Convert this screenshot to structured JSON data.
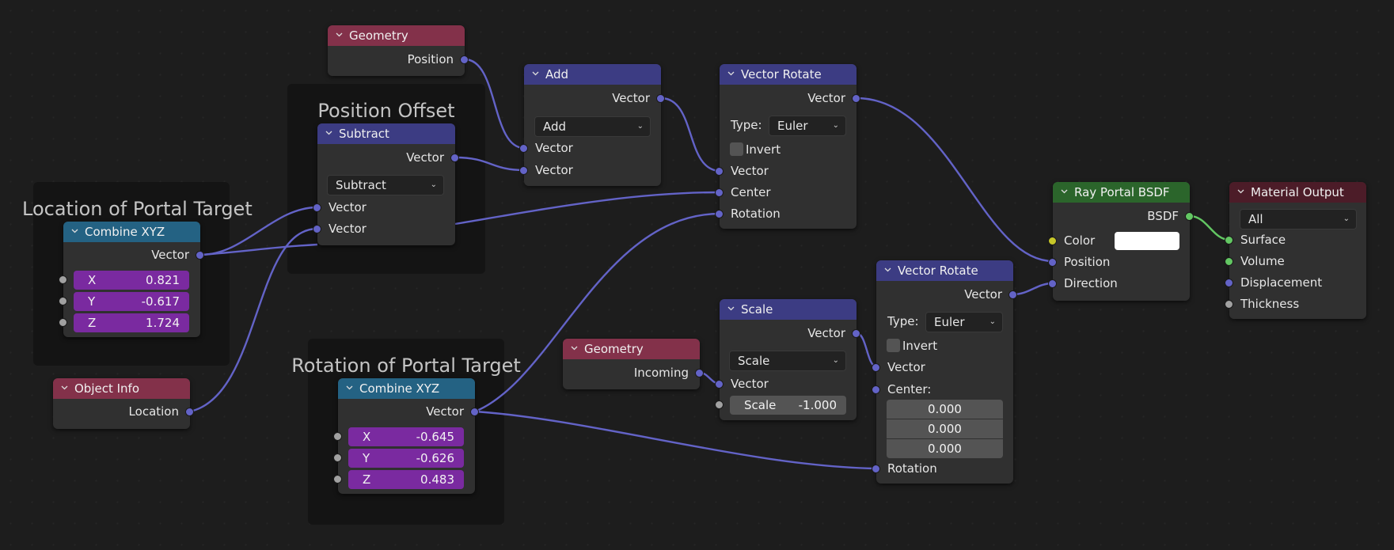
{
  "frames": [
    {
      "label": "Location of Portal Target"
    },
    {
      "label": "Position Offset"
    },
    {
      "label": "Rotation of Portal Target"
    }
  ],
  "nodes": {
    "geometry_top": {
      "title": "Geometry",
      "outputs": [
        "Position"
      ]
    },
    "subtract": {
      "title": "Subtract",
      "output": "Vector",
      "operation": "Subtract",
      "inputs": [
        "Vector",
        "Vector"
      ]
    },
    "add": {
      "title": "Add",
      "output": "Vector",
      "operation": "Add",
      "inputs": [
        "Vector",
        "Vector"
      ]
    },
    "vector_rotate_top": {
      "title": "Vector Rotate",
      "output": "Vector",
      "type_label": "Type:",
      "type_value": "Euler",
      "invert_label": "Invert",
      "inputs": [
        "Vector",
        "Center",
        "Rotation"
      ]
    },
    "combine_location": {
      "title": "Combine XYZ",
      "output": "Vector",
      "fields": [
        {
          "label": "X",
          "value": "0.821"
        },
        {
          "label": "Y",
          "value": "-0.617"
        },
        {
          "label": "Z",
          "value": "1.724"
        }
      ]
    },
    "object_info": {
      "title": "Object Info",
      "outputs": [
        "Location"
      ]
    },
    "combine_rotation": {
      "title": "Combine XYZ",
      "output": "Vector",
      "fields": [
        {
          "label": "X",
          "value": "-0.645"
        },
        {
          "label": "Y",
          "value": "-0.626"
        },
        {
          "label": "Z",
          "value": "0.483"
        }
      ]
    },
    "geometry_bottom": {
      "title": "Geometry",
      "outputs": [
        "Incoming"
      ]
    },
    "scale": {
      "title": "Scale",
      "output": "Vector",
      "operation": "Scale",
      "inputs": [
        "Vector"
      ],
      "scale_label": "Scale",
      "scale_value": "-1.000"
    },
    "vector_rotate_bottom": {
      "title": "Vector Rotate",
      "output": "Vector",
      "type_label": "Type:",
      "type_value": "Euler",
      "invert_label": "Invert",
      "inputs": [
        "Vector",
        "Center:",
        "Rotation"
      ],
      "center_values": [
        "0.000",
        "0.000",
        "0.000"
      ]
    },
    "ray_portal": {
      "title": "Ray Portal BSDF",
      "output": "BSDF",
      "inputs": [
        "Color",
        "Position",
        "Direction"
      ],
      "color_value": "#ffffff"
    },
    "material_output": {
      "title": "Material Output",
      "target": "All",
      "inputs": [
        "Surface",
        "Volume",
        "Displacement",
        "Thickness"
      ]
    }
  },
  "colors": {
    "header_input": "#83314a",
    "header_vector": "#3c3c83",
    "header_converter": "#246283",
    "header_shader": "#2b652b",
    "header_output": "#4c1c28",
    "socket_vector": "#6363c7",
    "socket_shader": "#63c763",
    "socket_color": "#c7c729",
    "socket_float": "#a1a1a1",
    "field_purple": "#7a2aa0"
  }
}
